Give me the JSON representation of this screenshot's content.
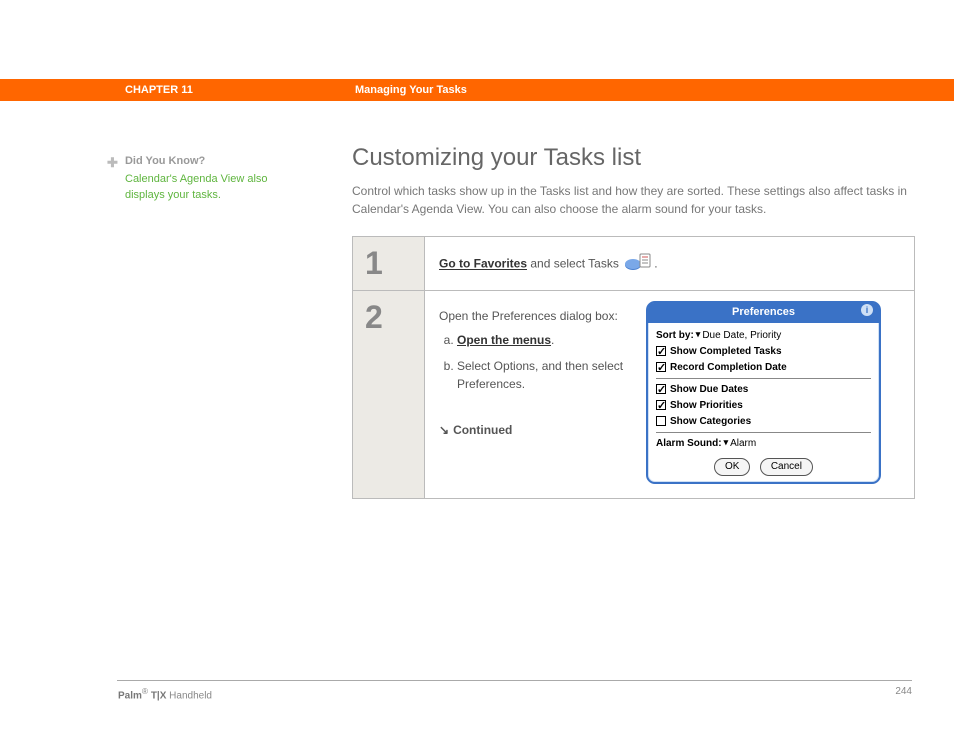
{
  "header": {
    "chapter": "CHAPTER 11",
    "title": "Managing Your Tasks"
  },
  "sidebar": {
    "dyk_label": "Did You Know?",
    "dyk_body": "Calendar's Agenda View also displays your tasks."
  },
  "main": {
    "heading": "Customizing your Tasks list",
    "intro": "Control which tasks show up in the Tasks list and how they are sorted. These settings also affect tasks in Calendar's Agenda View. You can also choose the alarm sound for your tasks."
  },
  "steps": [
    {
      "num": "1",
      "link": "Go to Favorites",
      "rest": " and select Tasks ",
      "period": "."
    },
    {
      "num": "2",
      "lead": "Open the Preferences dialog box:",
      "a_link": "Open the menus",
      "a_rest": ".",
      "b": "Select Options, and then select Preferences.",
      "continued": "Continued"
    }
  ],
  "prefs": {
    "title": "Preferences",
    "sortby_label": "Sort by:",
    "sortby_value": "Due Date, Priority",
    "items": [
      {
        "label": "Show Completed Tasks",
        "checked": true
      },
      {
        "label": "Record Completion Date",
        "checked": true
      },
      {
        "label": "Show Due Dates",
        "checked": true
      },
      {
        "label": "Show Priorities",
        "checked": true
      },
      {
        "label": "Show Categories",
        "checked": false
      }
    ],
    "alarm_label": "Alarm Sound:",
    "alarm_value": "Alarm",
    "ok": "OK",
    "cancel": "Cancel"
  },
  "footer": {
    "brand_bold": "Palm",
    "brand_sup": "®",
    "brand_mid": " T|X",
    "brand_rest": " Handheld",
    "page": "244"
  }
}
